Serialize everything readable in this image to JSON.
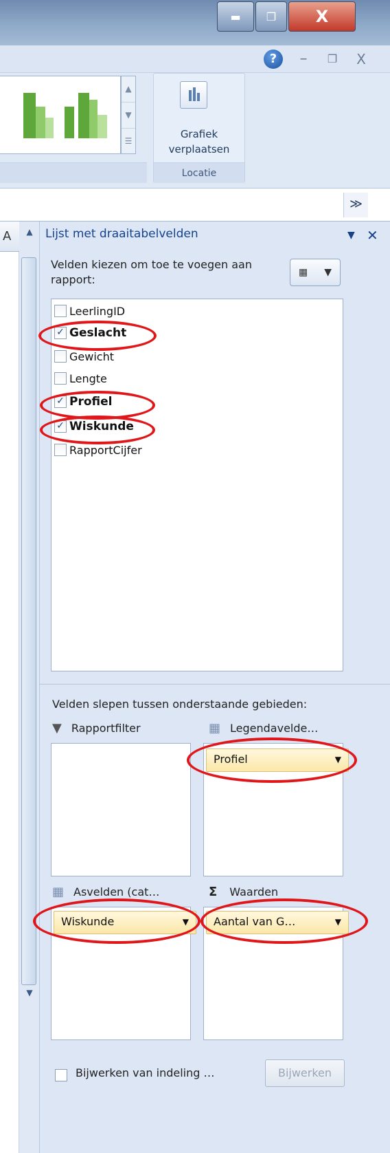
{
  "window": {
    "minimize_glyph": "▬",
    "maximize_glyph": "❐",
    "close_glyph": "X"
  },
  "ribbon": {
    "help_glyph": "?",
    "minimize_glyph": "–",
    "restore_glyph": "❐",
    "close_glyph": "X",
    "move_chart_label_line1": "Grafiek",
    "move_chart_label_line2": "verplaatsen",
    "group_location_label": "Locatie"
  },
  "formula_bar": {
    "expand_glyph": "≫"
  },
  "sheet": {
    "column_header": "A"
  },
  "pivot_pane": {
    "title": "Lijst met draaitabelvelden",
    "choose_fields_label": "Velden kiezen om toe te voegen aan rapport:",
    "fields": [
      {
        "name": "LeerlingID",
        "checked": false
      },
      {
        "name": "Geslacht",
        "checked": true
      },
      {
        "name": "Gewicht",
        "checked": false
      },
      {
        "name": "Lengte",
        "checked": false
      },
      {
        "name": "Profiel",
        "checked": true
      },
      {
        "name": "Wiskunde",
        "checked": true
      },
      {
        "name": "RapportCijfer",
        "checked": false
      }
    ],
    "check_glyph": "✓",
    "drag_label": "Velden slepen tussen onderstaande gebieden:",
    "areas": {
      "report_filter": "Rapportfilter",
      "legend_fields": "Legendavelde…",
      "axis_fields": "Asvelden (cat…",
      "values": "Waarden"
    },
    "chips": {
      "legend": "Profiel",
      "axis": "Wiskunde",
      "values": "Aantal van G…"
    },
    "sigma_glyph": "Σ",
    "defer_label": "Bijwerken van indeling …",
    "update_button": "Bijwerken"
  },
  "colors": {
    "highlight": "#e0171a",
    "pane_title": "#15428b",
    "chart_bar_dark": "#5ea73b",
    "chart_bar_light": "#b9e09d"
  }
}
